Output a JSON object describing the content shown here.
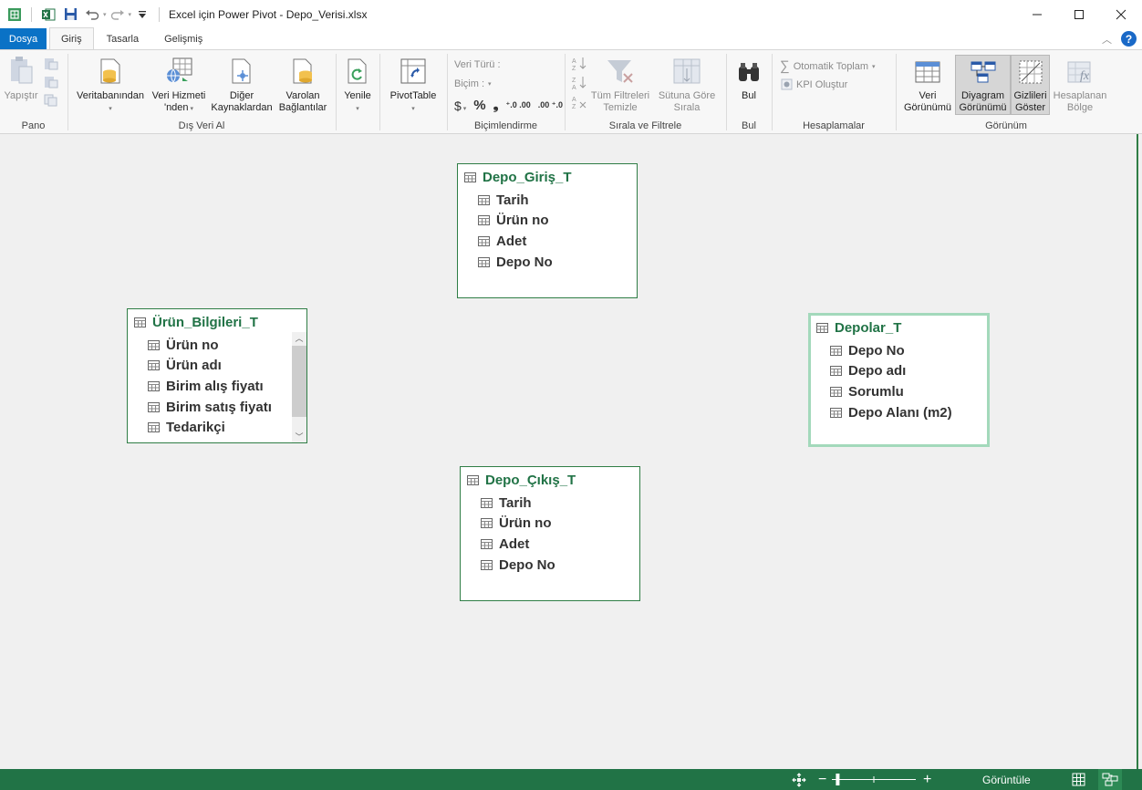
{
  "window": {
    "title": "Excel için Power Pivot - Depo_Verisi.xlsx",
    "minimize_icon": "minimize-icon",
    "maximize_icon": "maximize-icon",
    "close_icon": "close-icon"
  },
  "quick_access": [
    "powerpivot-logo-icon",
    "excel-icon",
    "save-icon",
    "undo-icon",
    "redo-icon",
    "customize-dropdown-icon"
  ],
  "tabs": [
    {
      "label": "Dosya"
    },
    {
      "label": "Giriş"
    },
    {
      "label": "Tasarla"
    },
    {
      "label": "Gelişmiş"
    }
  ],
  "ribbon": {
    "pano": {
      "label": "Pano",
      "paste": "Yapıştır"
    },
    "dis_veri": {
      "label": "Dış Veri Al",
      "veritabanindan": "Veritabanından",
      "veri_hizmeti_1": "Veri Hizmeti",
      "veri_hizmeti_2": "'nden",
      "diger_1": "Diğer",
      "diger_2": "Kaynaklardan",
      "varolan_1": "Varolan",
      "varolan_2": "Bağlantılar"
    },
    "yenile": "Yenile",
    "pivottable": "PivotTable",
    "bicimlendirme": {
      "label": "Biçimlendirme",
      "veri_turu": "Veri Türü :",
      "bicim": "Biçim :",
      "currency": "$",
      "percent": "%",
      "comma": "❟",
      "inc_dec": "⁺.0 .00",
      "dec_dec": ".00 ⁺.0"
    },
    "sirala": {
      "label": "Sırala ve Filtrele",
      "tum_1": "Tüm Filtreleri",
      "tum_2": "Temizle",
      "sutun_1": "Sütuna Göre",
      "sutun_2": "Sırala"
    },
    "bul": {
      "label": "Bul",
      "button": "Bul"
    },
    "hesaplamalar": {
      "label": "Hesaplamalar",
      "otomatik": "Otomatik Toplam",
      "kpi": "KPI Oluştur"
    },
    "gorunum": {
      "label": "Görünüm",
      "veri_1": "Veri",
      "veri_2": "Görünümü",
      "diyagram_1": "Diyagram",
      "diyagram_2": "Görünümü",
      "gizli_1": "Gizlileri",
      "gizli_2": "Göster",
      "hesap_1": "Hesaplanan",
      "hesap_2": "Bölge"
    }
  },
  "tables": [
    {
      "name": "Depo_Giriş_T",
      "fields": [
        "Tarih",
        "Ürün no",
        "Adet",
        "Depo No"
      ]
    },
    {
      "name": "Ürün_Bilgileri_T",
      "fields": [
        "Ürün no",
        "Ürün adı",
        "Birim alış fiyatı",
        "Birim satış fiyatı",
        "Tedarikçi"
      ]
    },
    {
      "name": "Depolar_T",
      "fields": [
        "Depo No",
        "Depo adı",
        "Sorumlu",
        "Depo Alanı (m2)"
      ]
    },
    {
      "name": "Depo_Çıkış_T",
      "fields": [
        "Tarih",
        "Ürün no",
        "Adet",
        "Depo No"
      ]
    }
  ],
  "statusbar": {
    "gorunum_label": "Görüntüle",
    "zoom_minus": "−",
    "zoom_plus": "+",
    "zoom_percent": 0.5
  }
}
